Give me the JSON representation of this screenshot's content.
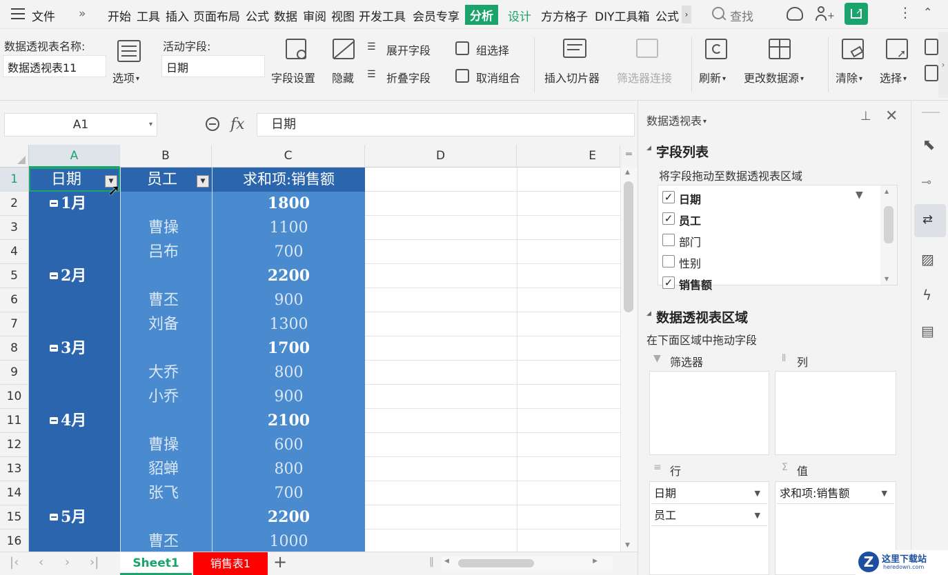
{
  "menubar": {
    "file_label": "文件",
    "more_label": "»",
    "tabs": [
      "开始",
      "工具",
      "插入",
      "页面布局",
      "公式",
      "数据",
      "审阅",
      "视图",
      "开发工具",
      "会员专享"
    ],
    "active_tab": "分析",
    "design_tab": "设计",
    "extra_tabs": [
      "方方格子",
      "DIY工具箱",
      "公式"
    ],
    "search_placeholder": "查找"
  },
  "ribbon": {
    "pivot_name_label": "数据透视表名称:",
    "pivot_name_value": "数据透视表11",
    "options_label": "选项",
    "active_field_label": "活动字段:",
    "active_field_value": "日期",
    "field_settings": "字段设置",
    "hide": "隐藏",
    "expand_field": "展开字段",
    "collapse_field": "折叠字段",
    "group_selection": "组选择",
    "ungroup": "取消组合",
    "insert_slicer": "插入切片器",
    "filter_connections": "筛选器连接",
    "refresh": "刷新",
    "change_source": "更改数据源",
    "clear": "清除",
    "select": "选择"
  },
  "formula_bar": {
    "cell_ref": "A1",
    "fx": "fx",
    "content": "日期"
  },
  "grid": {
    "columns": [
      "A",
      "B",
      "C",
      "D",
      "E"
    ],
    "rows": [
      {
        "n": "1",
        "a": "日期",
        "b": "员工",
        "c": "求和项:销售额"
      },
      {
        "n": "2",
        "a": "1月",
        "b": "",
        "c": "1800"
      },
      {
        "n": "3",
        "a": "",
        "b": "曹操",
        "c": "1100"
      },
      {
        "n": "4",
        "a": "",
        "b": "吕布",
        "c": "700"
      },
      {
        "n": "5",
        "a": "2月",
        "b": "",
        "c": "2200"
      },
      {
        "n": "6",
        "a": "",
        "b": "曹丕",
        "c": "900"
      },
      {
        "n": "7",
        "a": "",
        "b": "刘备",
        "c": "1300"
      },
      {
        "n": "8",
        "a": "3月",
        "b": "",
        "c": "1700"
      },
      {
        "n": "9",
        "a": "",
        "b": "大乔",
        "c": "800"
      },
      {
        "n": "10",
        "a": "",
        "b": "小乔",
        "c": "900"
      },
      {
        "n": "11",
        "a": "4月",
        "b": "",
        "c": "2100"
      },
      {
        "n": "12",
        "a": "",
        "b": "曹操",
        "c": "600"
      },
      {
        "n": "13",
        "a": "",
        "b": "貂蝉",
        "c": "800"
      },
      {
        "n": "14",
        "a": "",
        "b": "张飞",
        "c": "700"
      },
      {
        "n": "15",
        "a": "5月",
        "b": "",
        "c": "2200"
      },
      {
        "n": "16",
        "a": "",
        "b": "曹丕",
        "c": "1000"
      }
    ]
  },
  "sheet_tabs": {
    "sheet1": "Sheet1",
    "sheet2": "销售表1",
    "add": "+"
  },
  "panel": {
    "header": "数据透视表",
    "field_list_title": "字段列表",
    "field_list_hint": "将字段拖动至数据透视表区域",
    "fields": [
      {
        "label": "日期",
        "checked": "✓"
      },
      {
        "label": "员工",
        "checked": "✓"
      },
      {
        "label": "部门",
        "checked": ""
      },
      {
        "label": "性别",
        "checked": ""
      },
      {
        "label": "销售额",
        "checked": "✓"
      }
    ],
    "areas_title": "数据透视表区域",
    "areas_hint": "在下面区域中拖动字段",
    "filter_label": "筛选器",
    "column_label": "列",
    "row_label": "行",
    "value_label": "值",
    "row_items": [
      "日期",
      "员工"
    ],
    "value_items": [
      "求和项:销售额"
    ]
  },
  "watermark": {
    "text": "这里下载站",
    "url": "heredown.com"
  },
  "colors": {
    "accent": "#1aa36b",
    "pivot_dark": "#2a65ae",
    "pivot_light": "#4a8bd0",
    "sheet_red": "#ff0000"
  }
}
